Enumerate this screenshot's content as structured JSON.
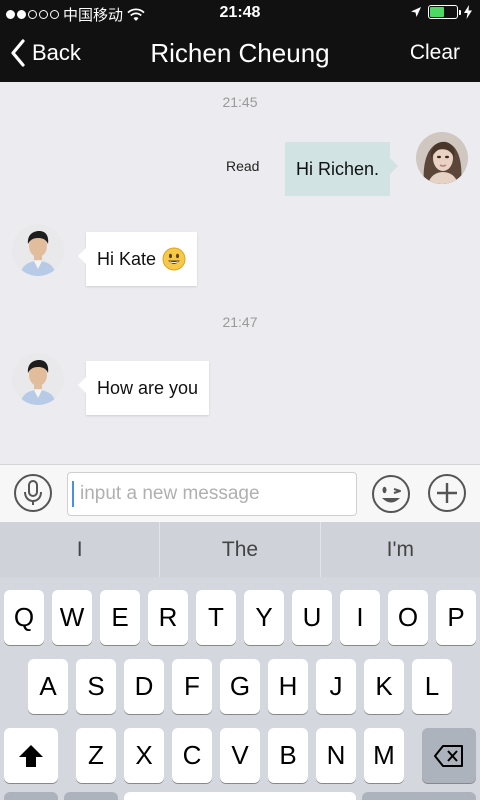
{
  "status_bar": {
    "carrier": "中国移动",
    "time": "21:48",
    "signal_bars": 5,
    "signal_filled": 2,
    "battery_level": 0.55
  },
  "nav": {
    "back_label": "Back",
    "title": "Richen Cheung",
    "clear_label": "Clear"
  },
  "chat": {
    "messages": [
      {
        "type": "timestamp",
        "text": "21:45"
      },
      {
        "type": "outgoing",
        "text": "Hi Richen.",
        "status": "Read"
      },
      {
        "type": "incoming",
        "text": "Hi Kate",
        "emoji": "smiley-icon"
      },
      {
        "type": "timestamp",
        "text": "21:47"
      },
      {
        "type": "incoming",
        "text": "How are you"
      }
    ]
  },
  "input": {
    "placeholder": "input a new message",
    "value": ""
  },
  "keyboard": {
    "suggestions": [
      "I",
      "The",
      "I'm"
    ],
    "row1": [
      "Q",
      "W",
      "E",
      "R",
      "T",
      "Y",
      "U",
      "I",
      "O",
      "P"
    ],
    "row2": [
      "A",
      "S",
      "D",
      "F",
      "G",
      "H",
      "J",
      "K",
      "L"
    ],
    "row3": [
      "Z",
      "X",
      "C",
      "V",
      "B",
      "N",
      "M"
    ]
  },
  "colors": {
    "nav_background": "#111111",
    "outgoing_bubble": "#d1e3e2",
    "incoming_bubble": "#ffffff",
    "battery": "#4cd964",
    "cursor": "#4a90e2"
  }
}
